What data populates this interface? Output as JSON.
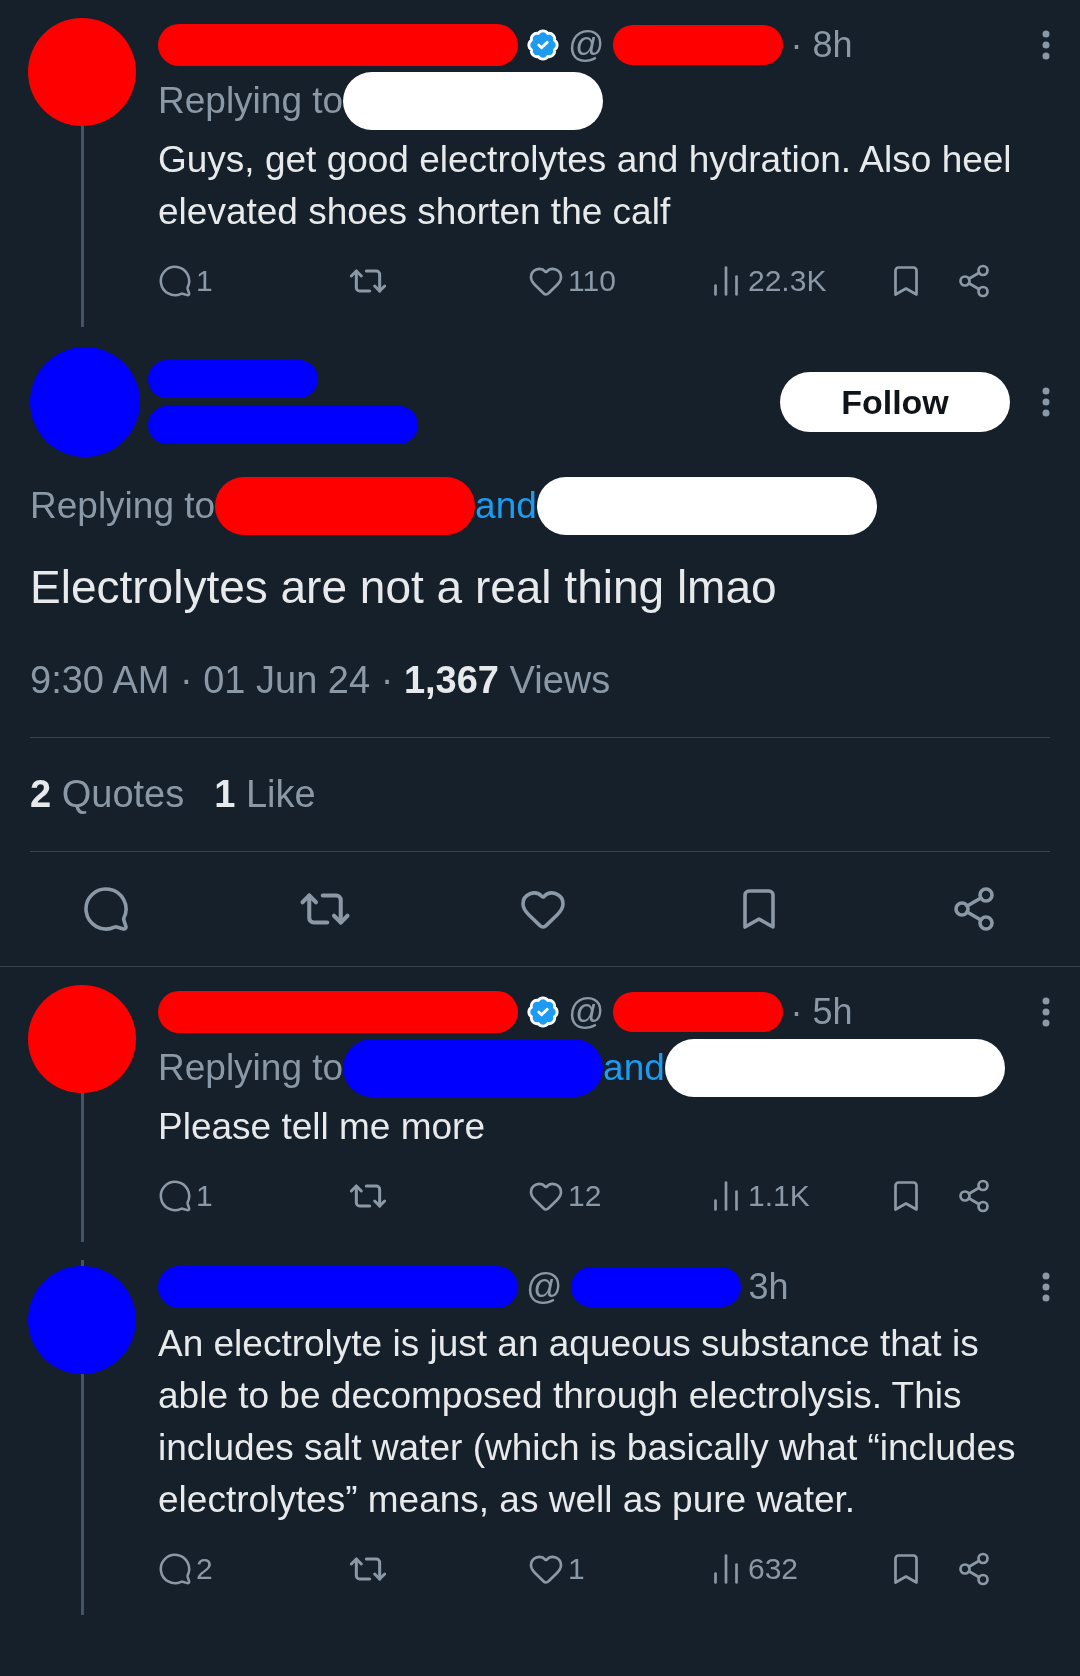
{
  "replies_before": [
    {
      "avatar": {
        "color": "#ff0000"
      },
      "name_redaction": {
        "color": "#ff0000"
      },
      "verified": true,
      "at": "@",
      "handle_redaction": {
        "color": "#ff0000"
      },
      "time": "· 8h",
      "replying_label": "Replying to",
      "replying_redactions": [
        {
          "color": "#ffffff"
        }
      ],
      "text": "Guys, get good electrolytes and hydration. Also heel elevated shoes shorten the calf",
      "actions": {
        "replies": "1",
        "likes": "110",
        "views": "22.3K"
      }
    }
  ],
  "main_tweet": {
    "avatar": {
      "color": "#0000ff"
    },
    "name_redaction": {
      "color": "#0000ff"
    },
    "handle_redaction": {
      "color": "#0000ff"
    },
    "follow_button": "Follow",
    "replying_label": "Replying to",
    "replying_redactions": [
      {
        "color": "#ff0000"
      },
      {
        "color": "#ffffff"
      }
    ],
    "and_label": "and",
    "text": "Electrolytes are not a real thing lmao",
    "meta": "9:30 AM · 01 Jun 24 · **1,367** Views",
    "stats": [
      "**2** Quotes",
      "**1** Like"
    ]
  },
  "replies_after": [
    {
      "avatar": {
        "color": "#ff0000"
      },
      "name_redaction": {
        "color": "#ff0000"
      },
      "verified": true,
      "at": "@",
      "handle_redaction": {
        "color": "#ff0000"
      },
      "time": "· 5h",
      "replying_label": "Replying to",
      "replying_redactions": [
        {
          "color": "#0000ff"
        },
        {
          "color": "#ffffff"
        }
      ],
      "and_label": "and",
      "text": "Please tell me more",
      "actions": {
        "replies": "1",
        "likes": "12",
        "views": "1.1K"
      }
    },
    {
      "avatar": {
        "color": "#0000ff"
      },
      "name_redaction": {
        "color": "#0000ff"
      },
      "verified": false,
      "at": "@",
      "handle_redaction": {
        "color": "#0000ff"
      },
      "time": "3h",
      "text": "An electrolyte is just an aqueous substance that is able to be decomposed through electrolysis. This includes salt water (which is basically what “includes electrolytes” means, as well as pure water.",
      "actions": {
        "replies": "2",
        "likes": "1",
        "views": "632"
      }
    }
  ]
}
